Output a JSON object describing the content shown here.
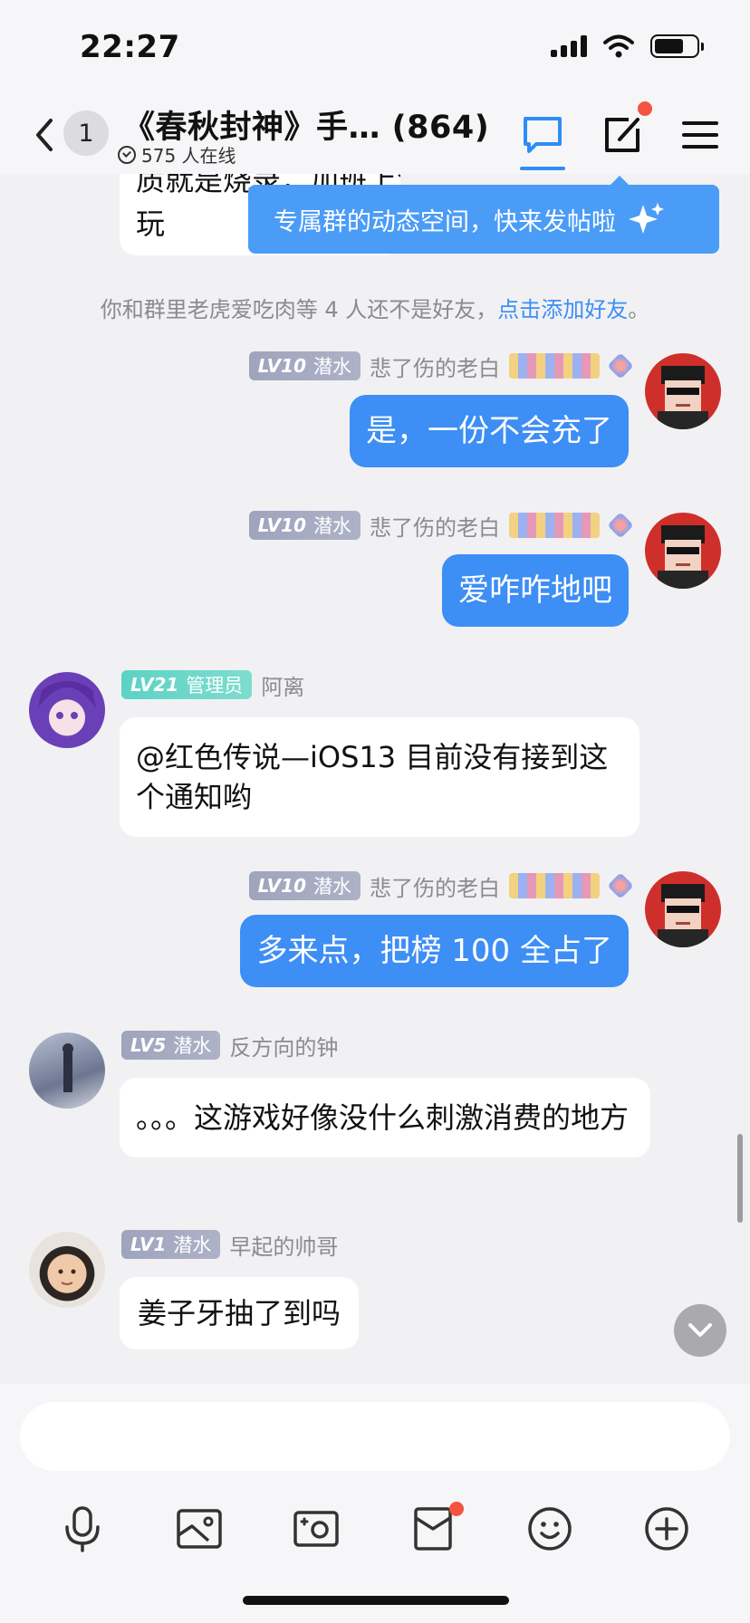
{
  "status_bar": {
    "time": "22:27"
  },
  "header": {
    "unread_count": "1",
    "group_title": "《春秋封神》手… (864)",
    "online_text": "575 人在线"
  },
  "tooltip": {
    "text": "专属群的动态空间，快来发帖啦"
  },
  "partial_message": {
    "line1": "质就是烧录，加班上游戏及被游戏",
    "line2": "玩"
  },
  "system_notice": {
    "prefix": "你和群里老虎爱吃肉等 4 人还不是好友，",
    "link": "点击添加好友",
    "suffix": "。"
  },
  "messages": [
    {
      "side": "out",
      "level": "LV10",
      "role": "潜水",
      "nickname": "悲了伤的老白",
      "text": "是，一份不会充了"
    },
    {
      "side": "out",
      "level": "LV10",
      "role": "潜水",
      "nickname": "悲了伤的老白",
      "text": "爱咋咋地吧"
    },
    {
      "side": "in",
      "level": "LV21",
      "role": "管理员",
      "nickname": "阿离",
      "text": "@红色传说—iOS13 目前没有接到这个通知哟"
    },
    {
      "side": "out",
      "level": "LV10",
      "role": "潜水",
      "nickname": "悲了伤的老白",
      "text": "多来点，把榜 100 全占了"
    },
    {
      "side": "in",
      "level": "LV5",
      "role": "潜水",
      "nickname": "反方向的钟",
      "text": "。。。这游戏好像没什么刺激消费的地方"
    },
    {
      "side": "in",
      "level": "LV1",
      "role": "潜水",
      "nickname": "早起的帅哥",
      "text": "姜子牙抽了到吗"
    }
  ],
  "input": {
    "value": "",
    "placeholder": ""
  },
  "toolbar": [
    "microphone-icon",
    "image-icon",
    "camera-icon",
    "red-packet-icon",
    "emoji-icon",
    "plus-icon"
  ],
  "colors": {
    "accent": "#3d8ef5",
    "badge_red": "#f4533f",
    "admin_badge": "#5bd3c4"
  }
}
